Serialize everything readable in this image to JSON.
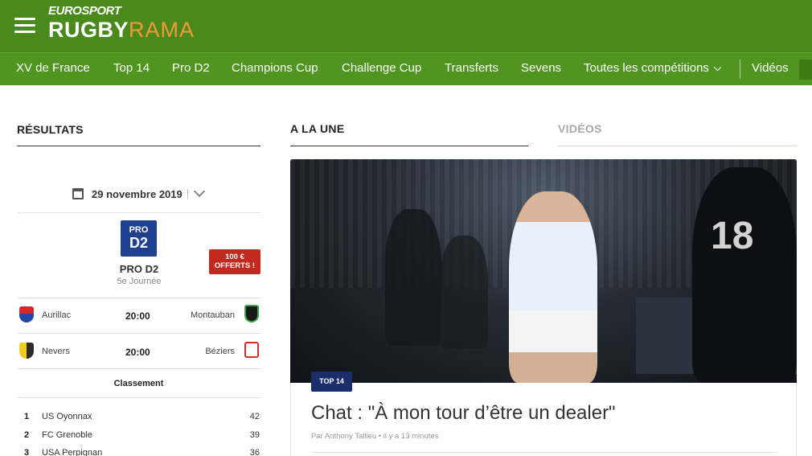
{
  "header": {
    "logo_top": "EUROSPORT",
    "logo_rugby": "RUGBY",
    "logo_rama": "RAMA",
    "brand_green": "#4a8a1c",
    "accent_orange": "#f39a35"
  },
  "nav": {
    "items": [
      "XV de France",
      "Top 14",
      "Pro D2",
      "Champions Cup",
      "Challenge Cup",
      "Transferts",
      "Sevens",
      "Toutes les compétitions",
      "Vidéos"
    ]
  },
  "results": {
    "title": "RÉSULTATS",
    "date": "29 novembre 2019",
    "competition": {
      "logo_pro": "PRO",
      "logo_d2": "D2",
      "name": "PRO D2",
      "round": "5e Journée"
    },
    "promo": {
      "line1": "100 €",
      "line2": "OFFERTS !",
      "color": "#c32a1f"
    },
    "matches": [
      {
        "home": "Aurillac",
        "time": "20:00",
        "away": "Montauban"
      },
      {
        "home": "Nevers",
        "time": "20:00",
        "away": "Béziers"
      }
    ],
    "standings_title": "Classement",
    "standings": [
      {
        "rank": "1",
        "team": "US Oyonnax",
        "points": "42"
      },
      {
        "rank": "2",
        "team": "FC Grenoble",
        "points": "39"
      },
      {
        "rank": "3",
        "team": "USA Perpignan",
        "points": "36"
      }
    ]
  },
  "main": {
    "tab_headlines": "A LA UNE",
    "tab_videos": "VIDÉOS",
    "article": {
      "tag": "TOP 14",
      "tag_color": "#1c2d6b",
      "title": "Chat : \"À mon tour d’être un dealer\"",
      "byline": "Par Anthony Tallieu • il y a 13 minutes"
    }
  }
}
